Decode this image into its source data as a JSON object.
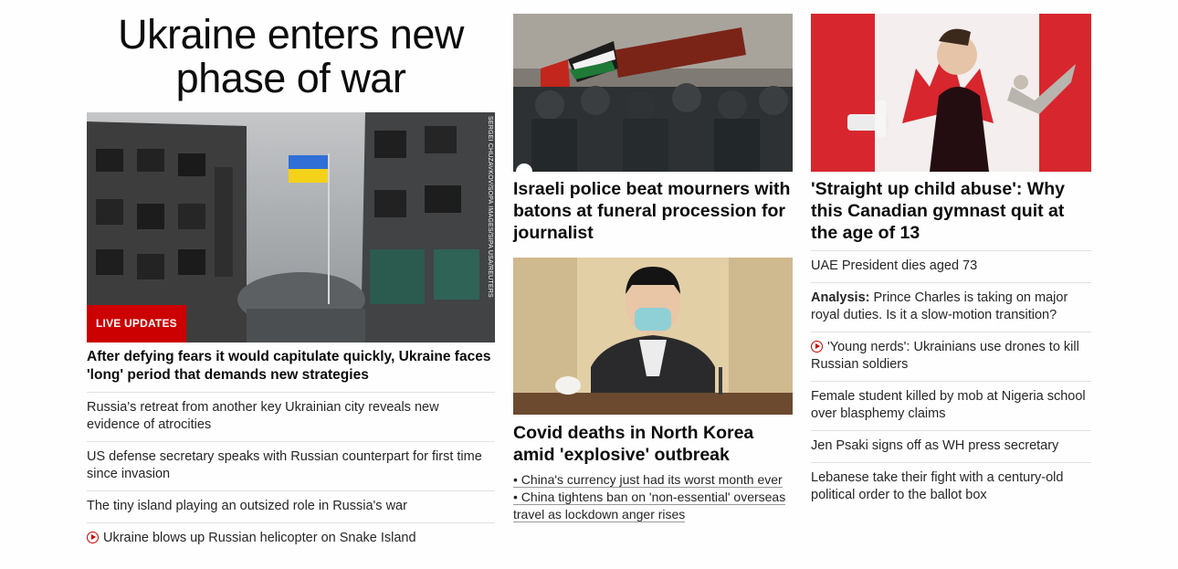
{
  "column1": {
    "main_title": "Ukraine enters new phase of war",
    "hero_photo_credit": "SERGEI CHUZAVKOV/SOPA IMAGES/SIPA USA/REUTERS",
    "live_badge": "LIVE UPDATES",
    "lead_headline": "After defying fears it would capitulate quickly, Ukraine faces 'long' period that demands new strategies",
    "stories": [
      {
        "text": "Russia's retreat from another key Ukrainian city reveals new evidence of atrocities"
      },
      {
        "text": "US defense secretary speaks with Russian counterpart for first time since invasion"
      },
      {
        "text": "The tiny island playing an outsized role in Russia's war"
      },
      {
        "text": "Ukraine blows up Russian helicopter on Snake Island",
        "video": true
      }
    ]
  },
  "column2": {
    "story1_headline": "Israeli police beat mourners with batons at funeral procession for journalist",
    "story2_headline": "Covid deaths in North Korea amid 'explosive' outbreak",
    "bullets": [
      "• China's currency just had its worst month ever",
      "• China tightens ban on 'non-essential' overseas travel as lockdown anger rises"
    ]
  },
  "column3": {
    "headline": "'Straight up child abuse': Why this Canadian gymnast quit at the age of 13",
    "stories": [
      {
        "text": "UAE President dies aged 73"
      },
      {
        "label": "Analysis:",
        "text": " Prince Charles is taking on major royal duties. Is it a slow-motion transition?"
      },
      {
        "text": "'Young nerds': Ukrainians use drones to kill Russian soldiers",
        "video": true
      },
      {
        "text": "Female student killed by mob at Nigeria school over blasphemy claims"
      },
      {
        "text": "Jen Psaki signs off as WH press secretary"
      },
      {
        "text": "Lebanese take their fight with a century-old political order to the ballot box"
      }
    ]
  },
  "colors": {
    "accent_red": "#cc0000",
    "text": "#0c0c0c",
    "divider": "#e1e1e1"
  }
}
